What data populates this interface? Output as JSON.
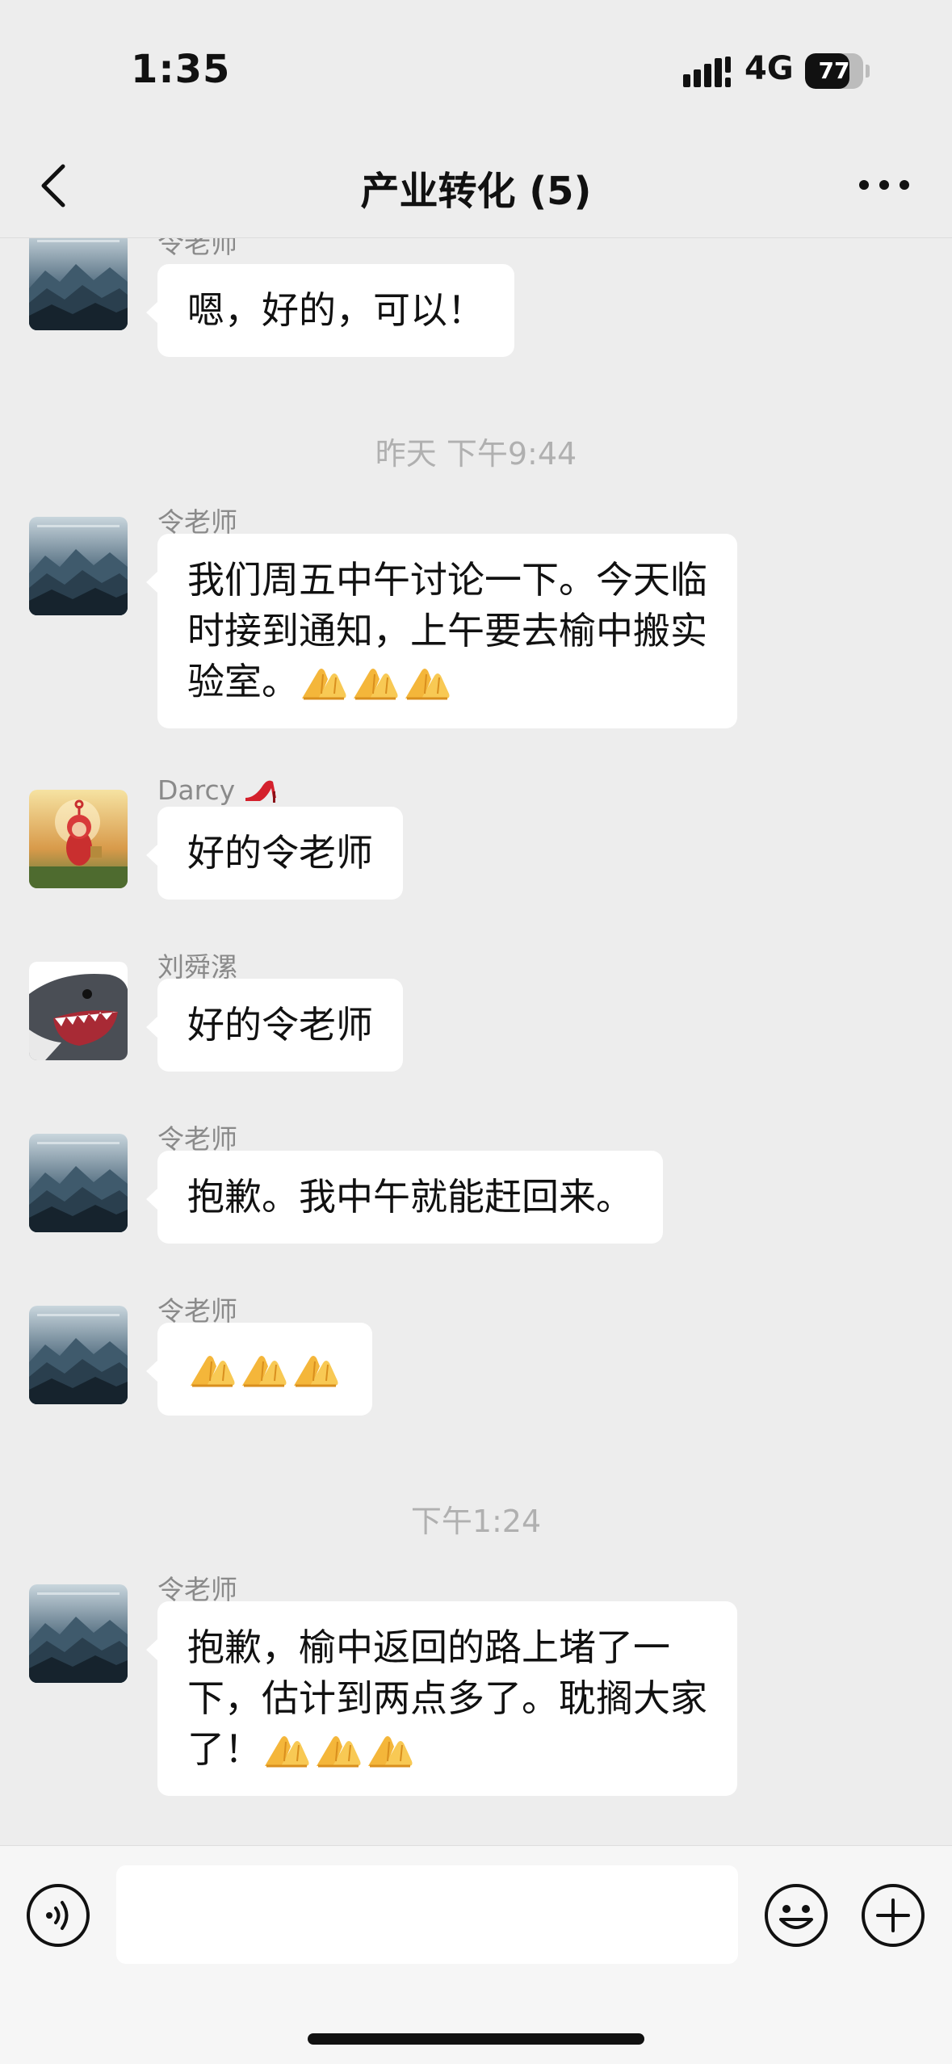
{
  "status_bar": {
    "time": "1:35",
    "network": "4G",
    "battery": "77",
    "battery_level": 0.77
  },
  "header": {
    "title": "产业转化 (5)"
  },
  "timestamps": [
    "昨天 下午9:44",
    "下午1:24"
  ],
  "messages": [
    {
      "sender": "令老师",
      "text": "嗯，好的，可以！",
      "avatar": "mountain-avatar"
    },
    {
      "sender": "令老师",
      "lines": [
        "我们周五中午讨论一下。今天临",
        "时接到通知，上午要去榆中搬实",
        "验室。"
      ],
      "emoji": "🙏🙏🙏",
      "avatar": "mountain-avatar"
    },
    {
      "sender": "Darcy",
      "sender_emoji": "👠",
      "text": "好的令老师",
      "avatar": "cartoon-avatar"
    },
    {
      "sender": "刘舜漯",
      "text": "好的令老师",
      "avatar": "shark-avatar"
    },
    {
      "sender": "令老师",
      "text": "抱歉。我中午就能赶回来。",
      "avatar": "mountain-avatar"
    },
    {
      "sender": "令老师",
      "emoji": "🙏🙏🙏",
      "avatar": "mountain-avatar"
    },
    {
      "sender": "令老师",
      "lines": [
        "抱歉，榆中返回的路上堵了一",
        "下，估计到两点多了。耽搁大家",
        "了！"
      ],
      "emoji": "🙏🙏🙏",
      "avatar": "mountain-avatar"
    }
  ],
  "input": {
    "value": "",
    "placeholder": ""
  },
  "icons": {
    "back": "chevron-left-icon",
    "more": "more-dots-icon",
    "voice": "voice-icon",
    "emoji": "emoji-icon",
    "plus": "plus-icon",
    "pray": "pray-emoji-icon",
    "heel": "high-heel-icon"
  }
}
